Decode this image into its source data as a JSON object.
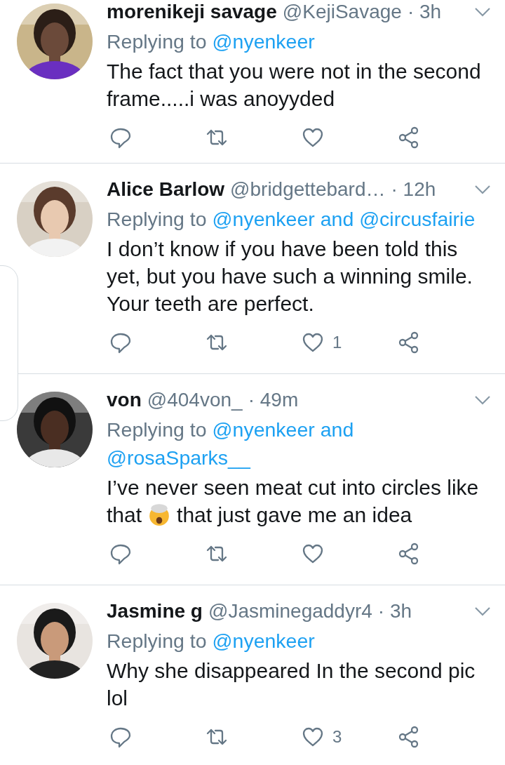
{
  "tweets": [
    {
      "name": "morenikeji savage",
      "handle": "@KejiSavage",
      "time": "· 3h",
      "replying_label": "Replying to",
      "reply_to": [
        "@nyenkeer"
      ],
      "body": [
        {
          "kind": "text",
          "text": "The fact that you were not in the second frame.....i was anoyyded"
        }
      ]
    },
    {
      "name": "Alice Barlow",
      "handle": "@bridgettebard…",
      "time": "· 12h",
      "replying_label": "Replying to",
      "reply_to": [
        "@nyenkeer and @circusfairie"
      ],
      "body": [
        {
          "kind": "text",
          "text": "I don’t know if you have been told this yet, but you have such a winning smile. Your teeth are perfect."
        }
      ],
      "like_count": "1"
    },
    {
      "name": "von",
      "handle": "@404von_",
      "time": "· 49m",
      "replying_label": "Replying to",
      "reply_to": [
        "@nyenkeer and",
        "@rosaSparks__"
      ],
      "body": [
        {
          "kind": "text",
          "text": "I’ve never seen meat cut into circles like"
        },
        {
          "kind": "text",
          "text": "that"
        },
        {
          "kind": "emoji"
        },
        {
          "kind": "text",
          "text": "that just gave me an idea"
        }
      ]
    },
    {
      "name": "Jasmine g",
      "handle": "@Jasminegaddyr4",
      "time": "· 3h",
      "replying_label": "Replying to",
      "reply_to": [
        "@nyenkeer"
      ],
      "body": [
        {
          "kind": "text",
          "text": "Why she disappeared In the second pic lol"
        }
      ],
      "like_count": "3"
    }
  ]
}
